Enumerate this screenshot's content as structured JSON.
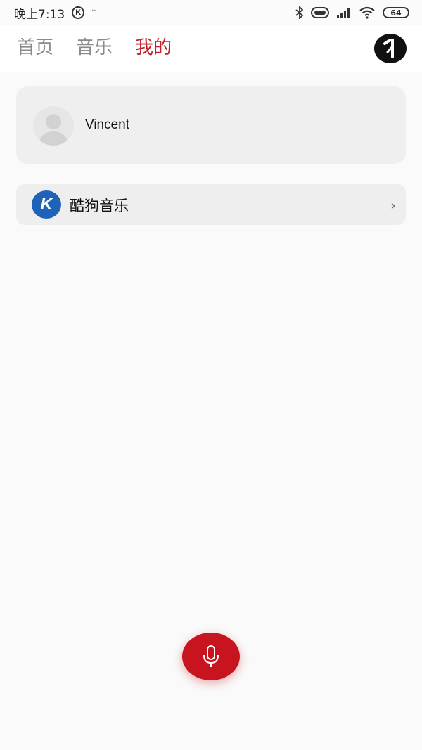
{
  "status_bar": {
    "time": "晚上7:13",
    "app_badge": "K",
    "extra": "···",
    "battery": "64"
  },
  "header": {
    "tabs": [
      {
        "label": "首页",
        "active": false
      },
      {
        "label": "音乐",
        "active": false
      },
      {
        "label": "我的",
        "active": true
      }
    ],
    "accent_color": "#c1212b"
  },
  "profile": {
    "name": "Vincent"
  },
  "connected_apps": [
    {
      "logo_letter": "K",
      "name": "酷狗音乐",
      "chevron": "›",
      "logo_color": "#1e63b8"
    }
  ],
  "mic": {
    "color": "#c8141e",
    "icon": "microphone-icon"
  }
}
